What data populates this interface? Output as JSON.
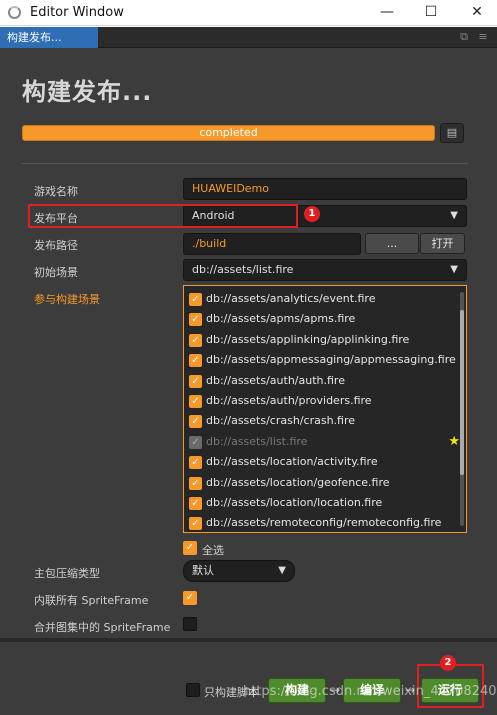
{
  "window": {
    "title": "Editor Window",
    "minimize": "—",
    "maximize": "☐",
    "close": "✕"
  },
  "tab": {
    "label": "构建发布...",
    "restore_icon": "⧉",
    "menu_icon": "≡"
  },
  "panel": {
    "heading": "构建发布...",
    "progress_text": "completed",
    "progress_value": 1.0,
    "progress_icon": "▤"
  },
  "fields": {
    "game_name": {
      "label": "游戏名称",
      "value": "HUAWEIDemo"
    },
    "platform": {
      "label": "发布平台",
      "value": "Android"
    },
    "build_path": {
      "label": "发布路径",
      "value": "./build",
      "browse": "...",
      "open": "打开"
    },
    "start_scene": {
      "label": "初始场景",
      "value": "db://assets/list.fire"
    },
    "scenes_label": "参与构建场景"
  },
  "scenes": [
    {
      "path": "db://assets/analytics/event.fire",
      "checked": true,
      "disabled": false
    },
    {
      "path": "db://assets/apms/apms.fire",
      "checked": true,
      "disabled": false
    },
    {
      "path": "db://assets/applinking/applinking.fire",
      "checked": true,
      "disabled": false
    },
    {
      "path": "db://assets/appmessaging/appmessaging.fire",
      "checked": true,
      "disabled": false
    },
    {
      "path": "db://assets/auth/auth.fire",
      "checked": true,
      "disabled": false
    },
    {
      "path": "db://assets/auth/providers.fire",
      "checked": true,
      "disabled": false
    },
    {
      "path": "db://assets/crash/crash.fire",
      "checked": true,
      "disabled": false
    },
    {
      "path": "db://assets/list.fire",
      "checked": true,
      "disabled": true
    },
    {
      "path": "db://assets/location/activity.fire",
      "checked": true,
      "disabled": false
    },
    {
      "path": "db://assets/location/geofence.fire",
      "checked": true,
      "disabled": false
    },
    {
      "path": "db://assets/location/location.fire",
      "checked": true,
      "disabled": false
    },
    {
      "path": "db://assets/remoteconfig/remoteconfig.fire",
      "checked": true,
      "disabled": false
    }
  ],
  "select_all": {
    "label": "全选"
  },
  "compression": {
    "label": "主包压缩类型",
    "value": "默认"
  },
  "inline_spriteframe": {
    "label": "内联所有 SpriteFrame"
  },
  "merge_spriteframe": {
    "label": "合并图集中的 SpriteFrame"
  },
  "actions": {
    "build_script_only": "只构建脚本",
    "build": "构建",
    "compile": "编译",
    "run": "运行"
  },
  "annotations": {
    "badge1": "1",
    "badge2": "2"
  },
  "watermark": "https://blog.csdn.net/weixin_44708240",
  "colors": {
    "accent": "#f7992a",
    "tab_active": "#2f6db5",
    "panel_bg": "#3c3c3c",
    "highlight": "#e02020",
    "green": "#4f8a2d"
  }
}
